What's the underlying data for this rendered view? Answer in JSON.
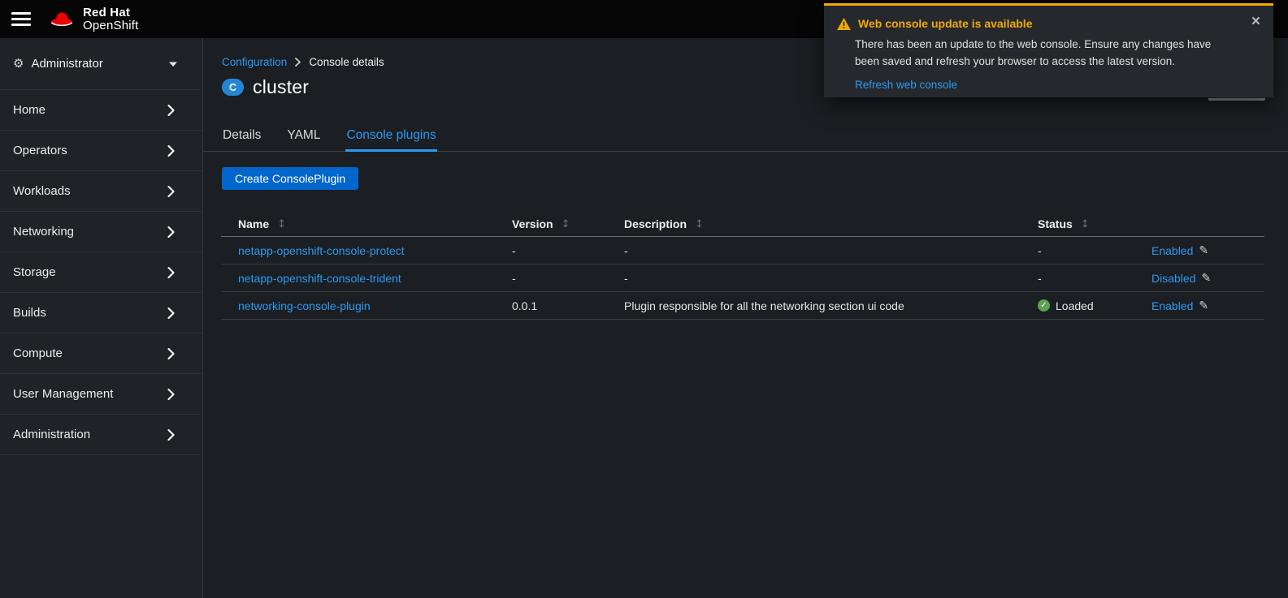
{
  "masthead": {
    "brand_line1": "Red Hat",
    "brand_line2": "OpenShift"
  },
  "toast": {
    "title": "Web console update is available",
    "body": "There has been an update to the web console. Ensure any changes have been saved and refresh your browser to access the latest version.",
    "link": "Refresh web console"
  },
  "sidebar": {
    "perspective": "Administrator",
    "items": [
      {
        "label": "Home"
      },
      {
        "label": "Operators"
      },
      {
        "label": "Workloads"
      },
      {
        "label": "Networking"
      },
      {
        "label": "Storage"
      },
      {
        "label": "Builds"
      },
      {
        "label": "Compute"
      },
      {
        "label": "User Management"
      },
      {
        "label": "Administration"
      }
    ]
  },
  "breadcrumb": {
    "link": "Configuration",
    "current": "Console details"
  },
  "page": {
    "badge": "C",
    "title": "cluster"
  },
  "tabs": [
    {
      "label": "Details"
    },
    {
      "label": "YAML"
    },
    {
      "label": "Console plugins"
    }
  ],
  "actions": {
    "create_button": "Create ConsolePlugin"
  },
  "table": {
    "headers": {
      "name": "Name",
      "version": "Version",
      "description": "Description",
      "status": "Status"
    },
    "rows": [
      {
        "name": "netapp-openshift-console-protect",
        "version": "-",
        "description": "-",
        "status": "-",
        "toggle": "Enabled"
      },
      {
        "name": "netapp-openshift-console-trident",
        "version": "-",
        "description": "-",
        "status": "-",
        "toggle": "Disabled"
      },
      {
        "name": "networking-console-plugin",
        "version": "0.0.1",
        "description": "Plugin responsible for all the networking section ui code",
        "status": "Loaded",
        "toggle": "Enabled"
      }
    ]
  },
  "colors": {
    "link": "#2b9af3",
    "warning": "#f0ab00",
    "primary_button": "#0066cc",
    "success_green": "#5ba352",
    "badge_blue": "#2586d7"
  }
}
